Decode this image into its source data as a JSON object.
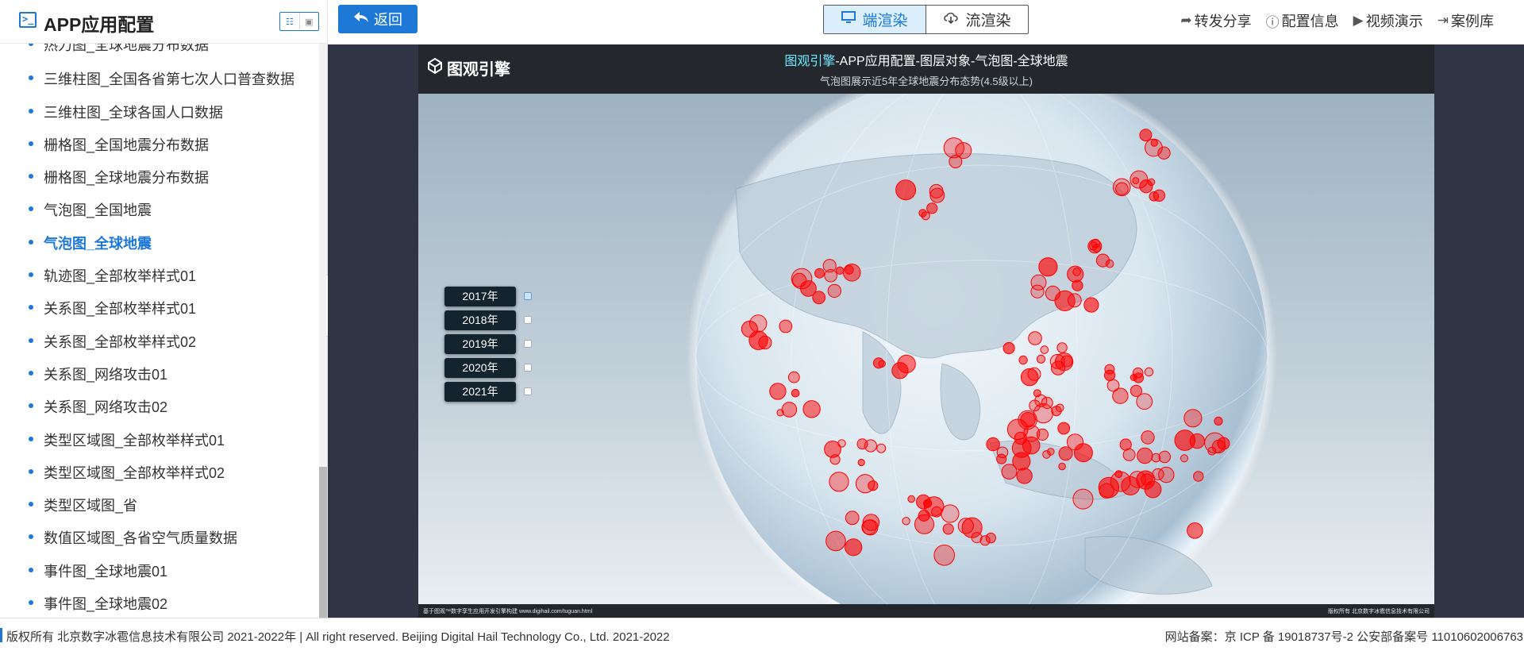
{
  "sidebar": {
    "title": "APP应用配置",
    "items": [
      {
        "label": "热力图_全球地震分布数据",
        "active": false
      },
      {
        "label": "三维柱图_全国各省第七次人口普查数据",
        "active": false
      },
      {
        "label": "三维柱图_全球各国人口数据",
        "active": false
      },
      {
        "label": "栅格图_全国地震分布数据",
        "active": false
      },
      {
        "label": "栅格图_全球地震分布数据",
        "active": false
      },
      {
        "label": "气泡图_全国地震",
        "active": false
      },
      {
        "label": "气泡图_全球地震",
        "active": true
      },
      {
        "label": "轨迹图_全部枚举样式01",
        "active": false
      },
      {
        "label": "关系图_全部枚举样式01",
        "active": false
      },
      {
        "label": "关系图_全部枚举样式02",
        "active": false
      },
      {
        "label": "关系图_网络攻击01",
        "active": false
      },
      {
        "label": "关系图_网络攻击02",
        "active": false
      },
      {
        "label": "类型区域图_全部枚举样式01",
        "active": false
      },
      {
        "label": "类型区域图_全部枚举样式02",
        "active": false
      },
      {
        "label": "类型区域图_省",
        "active": false
      },
      {
        "label": "数值区域图_各省空气质量数据",
        "active": false
      },
      {
        "label": "事件图_全球地震01",
        "active": false
      },
      {
        "label": "事件图_全球地震02",
        "active": false
      }
    ]
  },
  "topbar": {
    "back_label": "返回",
    "render_options": [
      {
        "label": "端渲染",
        "icon": "monitor-icon",
        "active": true
      },
      {
        "label": "流渲染",
        "icon": "cloud-download-icon",
        "active": false
      }
    ],
    "links": [
      {
        "label": "转发分享",
        "icon": "share-icon"
      },
      {
        "label": "配置信息",
        "icon": "info-icon"
      },
      {
        "label": "视频演示",
        "icon": "play-icon"
      },
      {
        "label": "案例库",
        "icon": "exit-icon"
      }
    ]
  },
  "stage": {
    "brand": "图观引擎",
    "title_highlight": "图观引擎",
    "title_rest": "-APP应用配置-图层对象-气泡图-全球地震",
    "subtitle": "气泡图展示近5年全球地震分布态势(4.5级以上)",
    "years": [
      {
        "label": "2017年",
        "checked": true
      },
      {
        "label": "2018年",
        "checked": false
      },
      {
        "label": "2019年",
        "checked": false
      },
      {
        "label": "2020年",
        "checked": false
      },
      {
        "label": "2021年",
        "checked": false
      }
    ],
    "footer_left": "基于图观™数字孪生应用开发引擎构建 www.digihail.com/tuguan.html",
    "footer_right": "版权所有 北京数字冰雹信息技术有限公司"
  },
  "footer": {
    "left": "版权所有 北京数字冰雹信息技术有限公司 2021-2022年 | All right reserved. Beijing Digital Hail Technology Co., Ltd. 2021-2022",
    "right": "网站备案：京 ICP 备 19018737号-2 公安部备案号 11010602006763"
  },
  "colors": {
    "accent": "#1e78d6",
    "bubble": "#ff0000",
    "highlight": "#6fe8ff"
  }
}
